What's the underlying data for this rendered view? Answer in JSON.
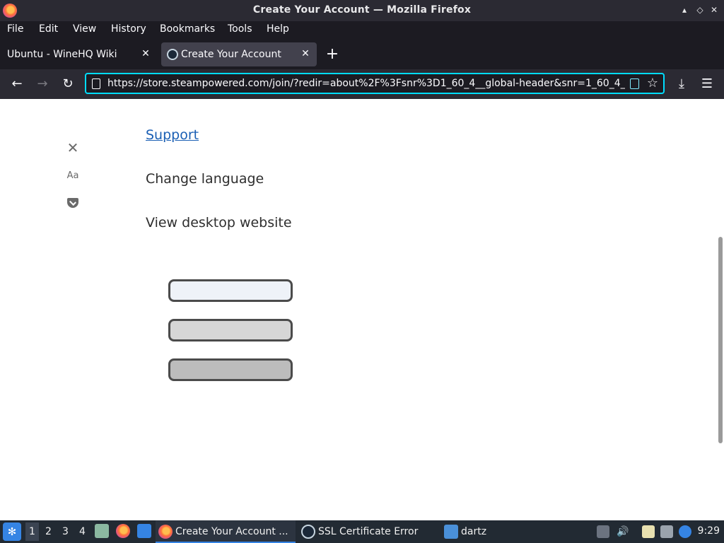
{
  "window": {
    "title": "Create Your Account — Mozilla Firefox",
    "controls": [
      "▴",
      "◇",
      "✕"
    ]
  },
  "menu": [
    "File",
    "Edit",
    "View",
    "History",
    "Bookmarks",
    "Tools",
    "Help"
  ],
  "tabs": [
    {
      "label": "Ubuntu - WineHQ Wiki",
      "active": false
    },
    {
      "label": "Create Your Account",
      "active": true
    }
  ],
  "newtab_label": "+",
  "nav": {
    "back": "←",
    "forward": "→",
    "reload": "↻",
    "url": "https://store.steampowered.com/join/?redir=about%2F%3Fsnr%3D1_60_4__global-header&snr=1_60_4_",
    "star": "☆",
    "downloads": "⤓",
    "menu": "☰"
  },
  "page": {
    "links": {
      "support": "Support",
      "change_language": "Change language",
      "view_desktop": "View desktop website"
    },
    "side_controls": {
      "close": "✕",
      "text_size": "Aa"
    },
    "buttons_colors": [
      "#eef2f8",
      "#d6d6d6",
      "#bcbcbc"
    ]
  },
  "taskbar": {
    "start_icon": "✻",
    "workspaces": [
      "1",
      "2",
      "3",
      "4"
    ],
    "tasks": [
      {
        "label": "Create Your Account ...",
        "active": true,
        "icon": "firefox-icon"
      },
      {
        "label": "SSL Certificate Error",
        "active": false,
        "icon": "steam-icon"
      },
      {
        "label": "dartz",
        "active": false,
        "icon": "folder-icon"
      }
    ],
    "clock": "9:29",
    "speaker": "🔊"
  }
}
